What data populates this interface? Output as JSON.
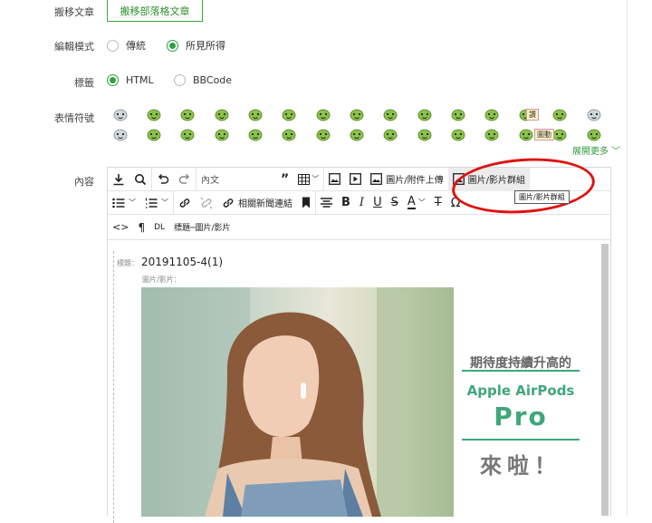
{
  "form": {
    "move_label": "搬移文章",
    "move_button": "搬移部落格文章",
    "mode_label": "編輯模式",
    "mode_options": [
      "傳統",
      "所見所得"
    ],
    "tag_label": "標籤",
    "tag_options": [
      "HTML",
      "BBCode"
    ],
    "emoji_label": "表情符號",
    "emoji_tags": [
      "讚",
      "圖動"
    ],
    "expand_more": "展開更多 ﹀",
    "content_label": "內容"
  },
  "toolbar": {
    "format_select": "內文",
    "attach_upload": "圖片/附件上傳",
    "image_video_group": "圖片/影片群組",
    "news_link": "相關新聞連結",
    "dl": "DL",
    "title_image_video": "標題─圖片/影片",
    "tooltip": "圖片/影片群組"
  },
  "content": {
    "title_label": "標題：",
    "title_value": "20191105-4(1)",
    "sub_label": "圖片/影片：",
    "banner_line1": "期待度持續升高的",
    "banner_line2": "Apple AirPods",
    "banner_line3": "Pro",
    "banner_line4": "來啦！"
  },
  "colors": {
    "accent": "#2ea043",
    "highlight": "#e01111",
    "banner_green": "#3fa77a"
  }
}
